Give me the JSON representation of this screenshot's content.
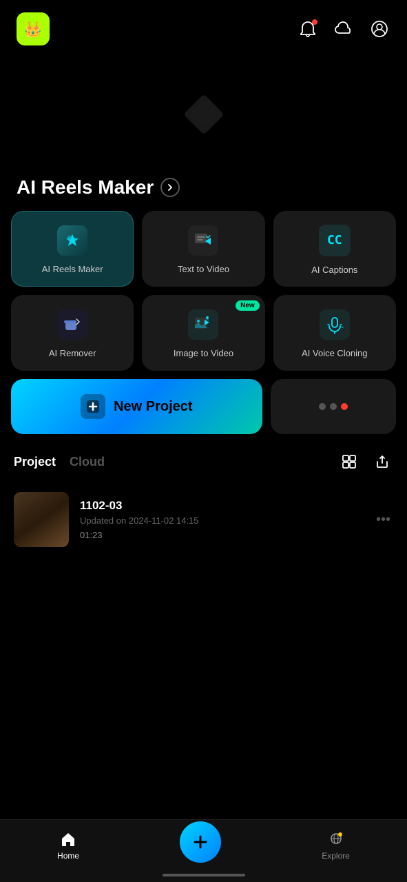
{
  "header": {
    "logo_alt": "App Logo"
  },
  "hero": {
    "icon_alt": "Diamond decoration"
  },
  "section": {
    "title": "AI Reels Maker",
    "arrow_label": "See more"
  },
  "tools": [
    {
      "id": "ai-reels-maker",
      "label": "AI Reels Maker",
      "active": true,
      "icon": "⚡",
      "icon_class": "icon-reels",
      "badge_new": false
    },
    {
      "id": "text-to-video",
      "label": "Text  to Video",
      "active": false,
      "icon": "✏️",
      "icon_class": "icon-text",
      "badge_new": false
    },
    {
      "id": "ai-captions",
      "label": "AI Captions",
      "active": false,
      "icon": "CC",
      "icon_class": "icon-captions",
      "badge_new": false
    },
    {
      "id": "ai-remover",
      "label": "AI Remover",
      "active": false,
      "icon": "🧹",
      "icon_class": "icon-remover",
      "badge_new": false
    },
    {
      "id": "image-to-video",
      "label": "Image to Video",
      "active": false,
      "icon": "🎬",
      "icon_class": "icon-image",
      "badge_new": true,
      "badge_text": "New"
    },
    {
      "id": "ai-voice-cloning",
      "label": "AI Voice Cloning",
      "active": false,
      "icon": "🎙️",
      "icon_class": "icon-voice",
      "badge_new": false
    }
  ],
  "new_project": {
    "label": "New Project"
  },
  "tabs": [
    {
      "id": "project",
      "label": "Project",
      "active": true
    },
    {
      "id": "cloud",
      "label": "Cloud",
      "active": false
    }
  ],
  "projects": [
    {
      "id": "proj1",
      "name": "1102-03",
      "updated": "Updated on 2024-11-02 14:15",
      "duration": "01:23"
    }
  ],
  "bottom_nav": [
    {
      "id": "home",
      "label": "Home",
      "active": true
    },
    {
      "id": "add",
      "label": "",
      "active": false
    },
    {
      "id": "explore",
      "label": "Explore",
      "active": false
    }
  ]
}
